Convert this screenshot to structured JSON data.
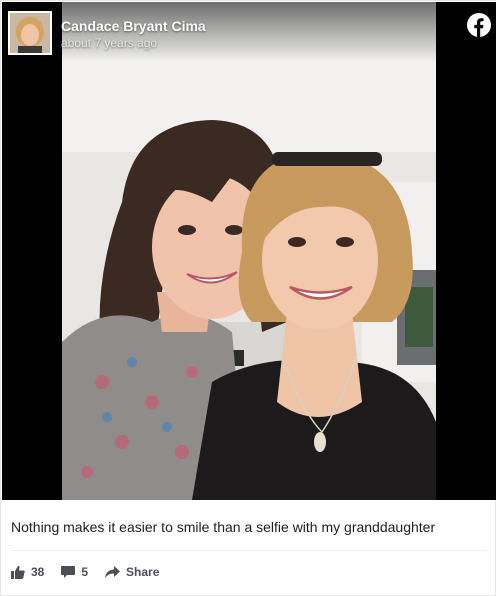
{
  "post": {
    "author": "Candace Bryant Cima",
    "timestamp": "about 7 years ago",
    "caption": "Nothing makes it easier to smile than a selfie with my granddaughter"
  },
  "actions": {
    "likes": "38",
    "comments": "5",
    "share_label": "Share"
  },
  "icons": {
    "brand": "facebook-logo-icon",
    "like": "thumbs-up-icon",
    "comment": "comment-bubble-icon",
    "share": "share-arrow-icon"
  },
  "colors": {
    "facebook": "#ffffff",
    "action_text": "#4b4f56",
    "caption_text": "#1c1e21"
  }
}
